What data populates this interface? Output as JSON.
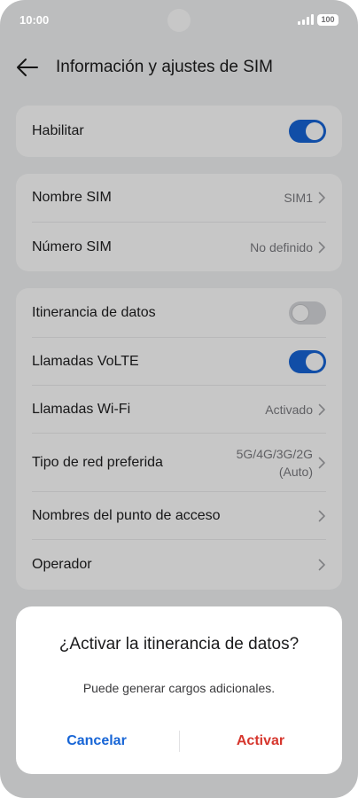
{
  "status_bar": {
    "time": "10:00",
    "battery": "100",
    "signal_icon": "signal-bars-icon",
    "battery_icon": "battery-icon"
  },
  "header": {
    "title": "Información y ajustes de SIM",
    "back_icon": "arrow-left-icon"
  },
  "enable_card": {
    "label": "Habilitar",
    "state": "on"
  },
  "sim_card": {
    "name_label": "Nombre SIM",
    "name_value": "SIM1",
    "number_label": "Número SIM",
    "number_value": "No definido"
  },
  "network_card": {
    "roaming_label": "Itinerancia de datos",
    "roaming_state": "off",
    "volte_label": "Llamadas VoLTE",
    "volte_state": "on",
    "wifi_calling_label": "Llamadas Wi-Fi",
    "wifi_calling_value": "Activado",
    "network_type_label": "Tipo de red preferida",
    "network_type_value_line1": "5G/4G/3G/2G",
    "network_type_value_line2": "(Auto)",
    "apn_label": "Nombres del punto de acceso",
    "operator_label": "Operador"
  },
  "dialog": {
    "title": "¿Activar la itinerancia de datos?",
    "message": "Puede generar cargos adicionales.",
    "cancel_label": "Cancelar",
    "activate_label": "Activar"
  },
  "colors": {
    "accent": "#1765d6",
    "danger": "#d6362d",
    "background": "#f1f2f4"
  }
}
